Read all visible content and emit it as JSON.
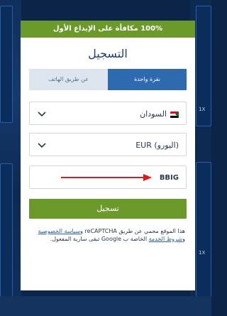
{
  "background": {
    "odds_label_1": "1X",
    "odds_label_2": "1X"
  },
  "banner": {
    "text": "100% مكافأة على الإيداع الأول"
  },
  "title": "التسجيل",
  "tabs": [
    {
      "label": "عن طريق الهاتف",
      "active": false
    },
    {
      "label": "نقرة واحدة",
      "active": true
    }
  ],
  "country": {
    "value": "السودان",
    "flag_icon": "sudan-flag-icon"
  },
  "currency": {
    "value": "EUR (اليورو)"
  },
  "promo": {
    "value": "BBIG",
    "annotation": "red-arrow-icon"
  },
  "submit_label": "تسجيل",
  "legal": {
    "part1": "هذا الموقع محمي عن طريق reCAPTCHA و",
    "privacy_link": "سياسة الخصوصية",
    "part2": " و",
    "terms_link": "شروط الخدمة",
    "part3": " الخاصة ب Google تبقى سارية المفعول."
  },
  "colors": {
    "accent_green": "#6b9a2a",
    "active_tab_blue": "#2e6ab0",
    "title_navy": "#1f3f66",
    "arrow_red": "#e0191d"
  }
}
